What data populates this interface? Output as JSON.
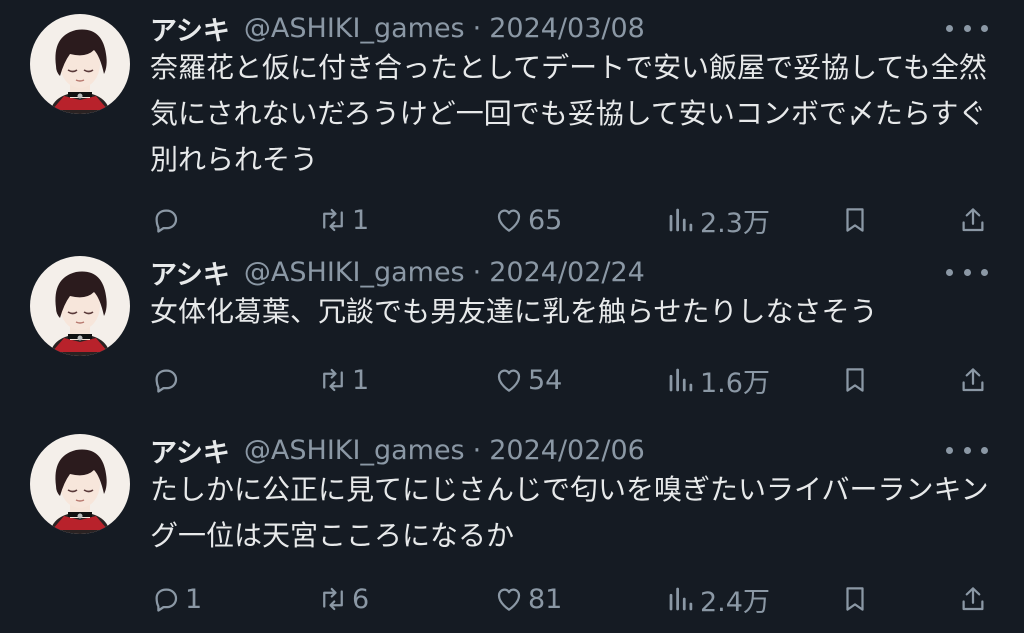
{
  "tweets": [
    {
      "display_name": "アシキ",
      "handle": "@ASHIKI_games",
      "separator": "·",
      "date": "2024/03/08",
      "text": "奈羅花と仮に付き合ったとしてデートで安い飯屋で妥協しても全然気にされないだろうけど一回でも妥協して安いコンボで〆たらすぐ別れられそう",
      "replies": "",
      "reposts": "1",
      "likes": "65",
      "views": "2.3万"
    },
    {
      "display_name": "アシキ",
      "handle": "@ASHIKI_games",
      "separator": "·",
      "date": "2024/02/24",
      "text": "女体化葛葉、冗談でも男友達に乳を触らせたりしなさそう",
      "replies": "",
      "reposts": "1",
      "likes": "54",
      "views": "1.6万"
    },
    {
      "display_name": "アシキ",
      "handle": "@ASHIKI_games",
      "separator": "·",
      "date": "2024/02/06",
      "text": "たしかに公正に見てにじさんじで匂いを嗅ぎたいライバーランキング一位は天宮こころになるか",
      "replies": "1",
      "reposts": "6",
      "likes": "81",
      "views": "2.4万"
    }
  ],
  "icons": {
    "reply": "reply-icon",
    "repost": "repost-icon",
    "like": "heart-icon",
    "views": "views-icon",
    "bookmark": "bookmark-icon",
    "share": "share-icon",
    "more": "more-icon"
  },
  "colors": {
    "background": "#151b23",
    "primary_text": "#e7e9ea",
    "secondary_text": "#8b98a5"
  }
}
